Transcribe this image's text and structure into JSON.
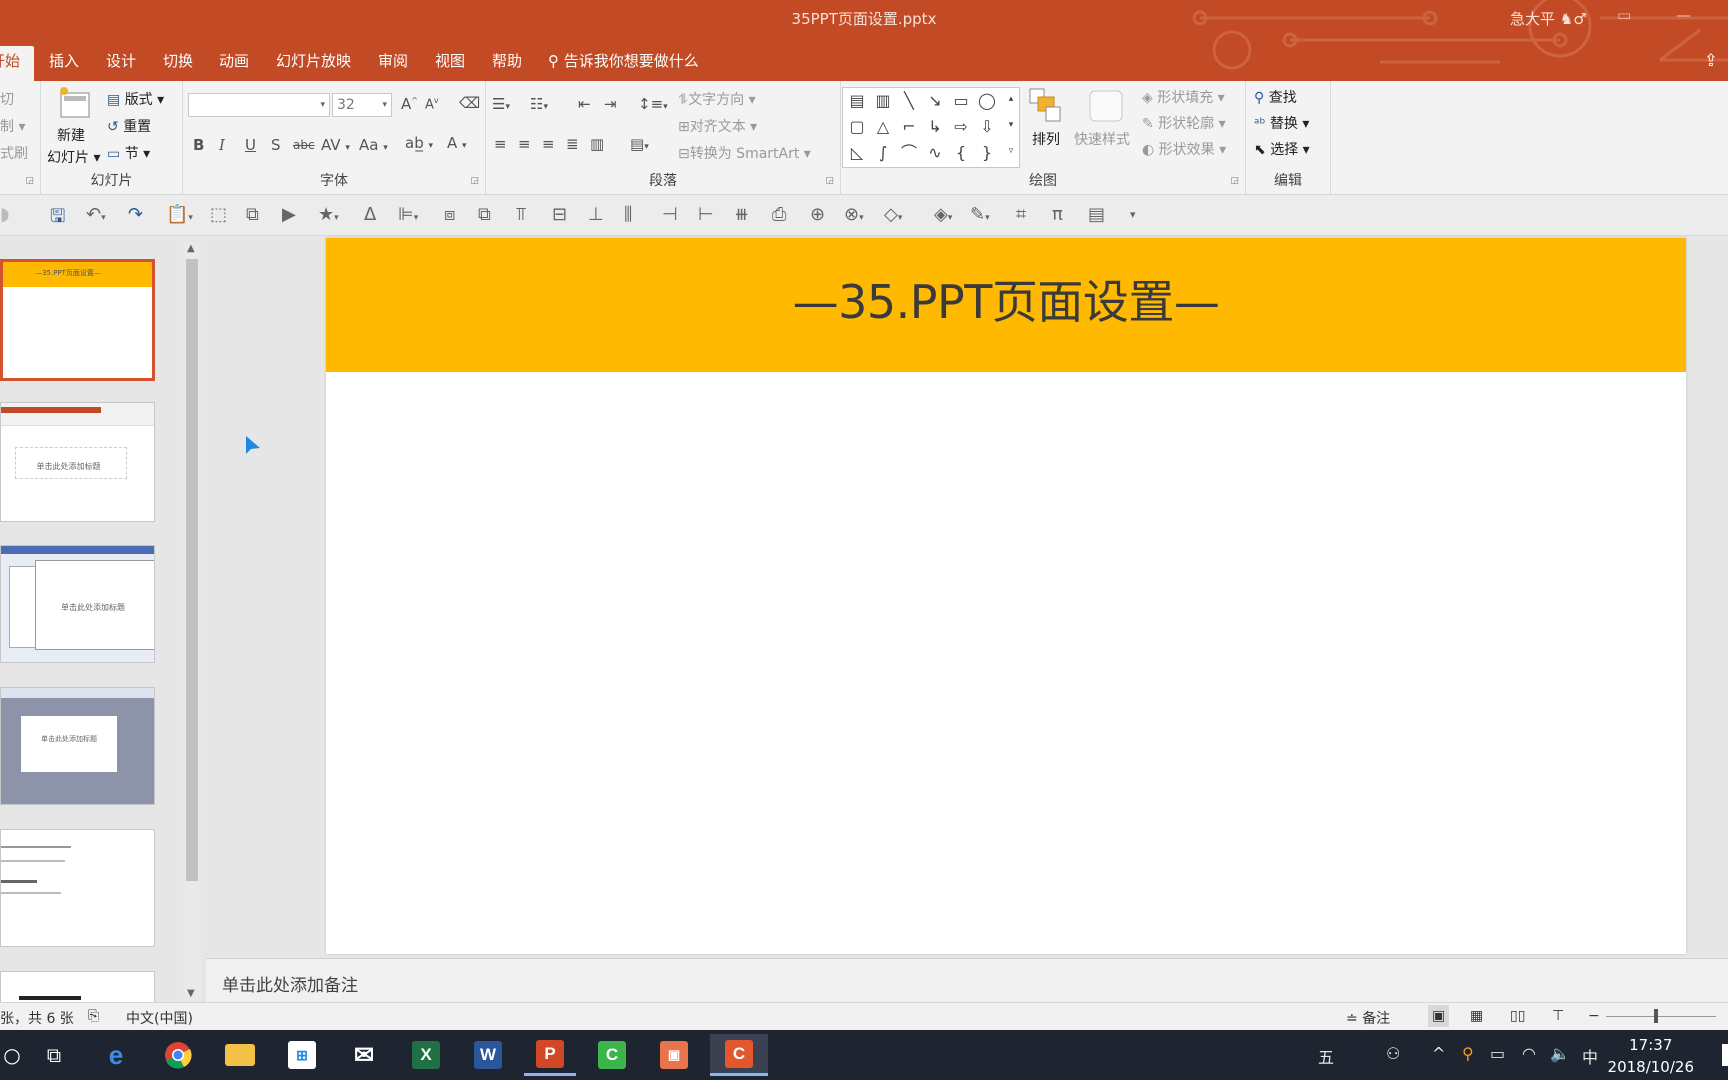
{
  "window": {
    "title": "35PPT页面设置.pptx",
    "user": "急大平 ♞♂",
    "share_icon": "share-icon"
  },
  "tabs": [
    {
      "label": "开始",
      "active": true
    },
    {
      "label": "插入"
    },
    {
      "label": "设计"
    },
    {
      "label": "切换"
    },
    {
      "label": "动画"
    },
    {
      "label": "幻灯片放映"
    },
    {
      "label": "审阅"
    },
    {
      "label": "视图"
    },
    {
      "label": "帮助"
    },
    {
      "label": "告诉我你想要做什么"
    }
  ],
  "ribbon": {
    "clipboard": {
      "cut": "切",
      "copy": "制 ▾",
      "painter": "式刷"
    },
    "slides": {
      "group_label": "幻灯片",
      "new_slide_line1": "新建",
      "new_slide_line2": "幻灯片 ▾",
      "layout": "版式 ▾",
      "reset": "重置",
      "section": "节 ▾"
    },
    "font": {
      "group_label": "字体",
      "font_name": "",
      "font_size": "32",
      "bold": "B",
      "italic": "I",
      "underline": "U",
      "strike": "S",
      "shadow": "abc",
      "spacing": "AV",
      "case": "Aa",
      "grow": "A",
      "shrink": "A",
      "color": "A"
    },
    "paragraph": {
      "group_label": "段落",
      "text_direction": "文字方向 ▾",
      "align_text": "对齐文本 ▾",
      "smartart": "转换为 SmartArt ▾"
    },
    "drawing": {
      "group_label": "绘图",
      "arrange": "排列",
      "quick_styles": "快速样式",
      "shape_fill": "形状填充 ▾",
      "shape_outline": "形状轮廓 ▾",
      "shape_effects": "形状效果 ▾"
    },
    "editing": {
      "group_label": "编辑",
      "find": "查找",
      "replace": "替换 ▾",
      "select": "选择 ▾"
    }
  },
  "slide": {
    "title": "—35.PPT页面设置—",
    "banner_color": "#ffb900"
  },
  "thumbnails": [
    {
      "index": 1,
      "text": "—35.PPT页面设置—",
      "selected": true
    },
    {
      "index": 2,
      "text": "单击此处添加标题"
    },
    {
      "index": 3,
      "text": "单击此处添加标题"
    },
    {
      "index": 4,
      "text": "单击此处添加标题"
    },
    {
      "index": 5,
      "text": ""
    },
    {
      "index": 6,
      "text": ""
    }
  ],
  "notes": {
    "placeholder": "单击此处添加备注"
  },
  "status": {
    "slide_count": "张，共 6 张",
    "language": "中文(中国)",
    "notes_button": "备注"
  },
  "taskbar": {
    "ime": "五",
    "ime2": "中",
    "time": "17:37",
    "date": "2018/10/26"
  },
  "colors": {
    "accent": "#c24a25",
    "ribbon_bg": "#f3f3f3",
    "slide_banner": "#ffb900"
  }
}
